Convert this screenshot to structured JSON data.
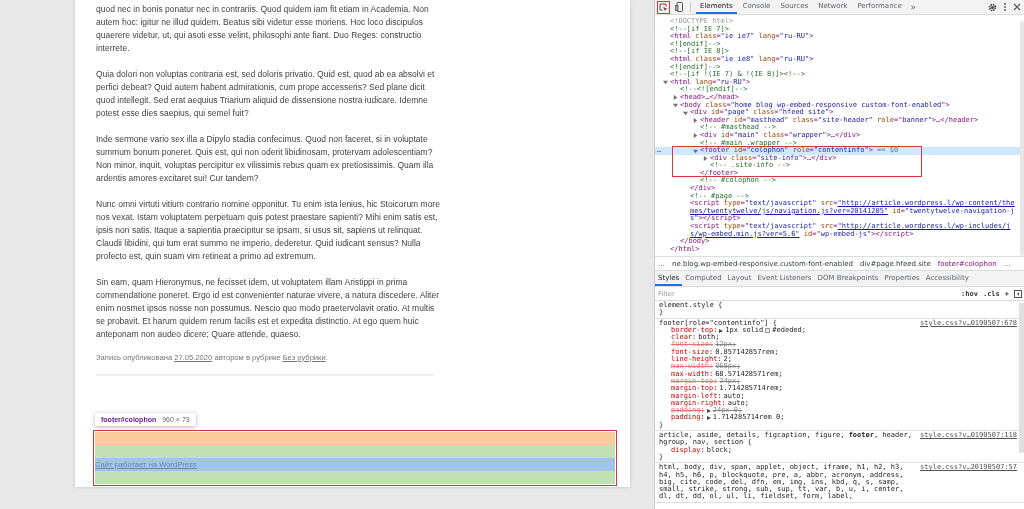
{
  "page": {
    "paragraphs": [
      "quod nec in bonis ponatur nec in contrariis. Quod quidem iam fit etiam in Academia. Non autem hoc: igitur ne illud quidem. Beatus sibi videtur esse moriens. Hoc loco discipulos quaerere videtur, ut, qui asoti esse velint, philosophi ante fiant. Duo Reges: constructio interrete.",
      "Quia dolori non voluptas contraria est, sed doloris privatio. Quid est, quod ab ea absolvi et perfici debeat? Quid autem habent admirationis, cum prope accesseris? Sed plane dicit quod intellegit. Sed erat aequius Triarium aliquid de dissensione nostra iudicare. Idemne potest esse dies saepius, qui semel fuit?",
      "Inde sermone vario sex illa a Dipylo stadia confecimus. Quod non faceret, si in voluptate summum bonum poneret. Quis est, qui non oderit libidinosam, protervam adolescentiam? Non minor, inquit, voluptas percipitur ex vilissimis rebus quam ex pretiosissimis. Quam illa ardentis amores excitaret sui! Cur tandem?",
      "Nunc omni virtuti vitium contrario nomine opponitur. Tu enim ista lenius, hic Stoicorum more nos vexat. Istam voluptatem perpetuam quis potest praestare sapienti? Mihi enim satis est, ipsis non satis. Itaque a sapientia praecipitur se ipsam, si usus sit, sapiens ut relinquat. Claudii libidini, qui tum erat summo ne imperio, dederetur. Quid iudicant sensus? Nulla profecto est, quin suam vim retineat a primo ad extremum.",
      "Sin eam, quam Hieronymus, ne fecisset idem, ut voluptatem illam Aristippi in prima commendatione poneret. Ergo id est convenienter naturae vivere, a natura discedere. Aliter enim nosmet ipsos nosse non possumus. Nescio quo modo praetervolavit oratio. At multis se probavit. Et harum quidem rerum facilis est et expedita distinctio. At ego quem huic anteponam non audeo dicere; Quare attende, quaeso."
    ],
    "post_meta": {
      "prefix": "Запись опубликована",
      "date": "27.05.2020",
      "middle": "автором в рубрике",
      "category": "Без рубрики",
      "suffix": "."
    },
    "inspect_tooltip": {
      "selector": "footer#colophon",
      "size": "960 × 73"
    },
    "footer_link": "Сайт работает на WordPress"
  },
  "devtools": {
    "tabs": [
      {
        "label": "Elements",
        "selected": true
      },
      {
        "label": "Console",
        "selected": false
      },
      {
        "label": "Sources",
        "selected": false
      },
      {
        "label": "Network",
        "selected": false
      },
      {
        "label": "Performance",
        "selected": false
      }
    ],
    "overflow": "»",
    "elements_tree": [
      {
        "kind": "doctype",
        "text": "<!DOCTYPE html>",
        "selected": false
      },
      {
        "kind": "comment",
        "text": "<!--[if IE 7]>",
        "selected": false
      },
      {
        "kind": "tag",
        "text": "<html class=\"ie ie7\" lang=\"ru-RU\">",
        "selected": false
      },
      {
        "kind": "comment",
        "text": "<![endif]-->",
        "selected": false
      },
      {
        "kind": "comment",
        "text": "<!--[if IE 8]>",
        "selected": false
      },
      {
        "kind": "tag",
        "text": "<html class=\"ie ie8\" lang=\"ru-RU\">",
        "selected": false
      },
      {
        "kind": "comment",
        "text": "<![endif]-->",
        "selected": false
      },
      {
        "kind": "comment",
        "text": "<!--[if !(IE 7) & !(IE 8)]><!-->",
        "selected": false
      },
      {
        "kind": "tag",
        "text": "<html lang=\"ru-RU\">",
        "selected": false,
        "expanded": true,
        "close": "</html>",
        "children": [
          {
            "kind": "comment",
            "text": "<!--<![endif]-->",
            "selected": false
          },
          {
            "kind": "tag",
            "text": "<head>…</head>",
            "selected": false,
            "expanded": false
          },
          {
            "kind": "tag",
            "text": "<body class=\"home blog wp-embed-responsive custom-font-enabled\">",
            "selected": false,
            "expanded": true,
            "close": "</body>",
            "children": [
              {
                "kind": "tag",
                "text": "<div id=\"page\" class=\"hfeed site\">",
                "selected": false,
                "expanded": true,
                "close": "</div>",
                "children": [
                  {
                    "kind": "tag",
                    "text": "<header id=\"masthead\" class=\"site-header\" role=\"banner\">…</header>",
                    "selected": false,
                    "expanded": false
                  },
                  {
                    "kind": "comment",
                    "text": "<!-- #masthead -->",
                    "selected": false
                  },
                  {
                    "kind": "tag",
                    "text": "<div id=\"main\" class=\"wrapper\">…</div>",
                    "selected": false,
                    "expanded": false
                  },
                  {
                    "kind": "comment",
                    "text": "<!-- #main .wrapper -->",
                    "selected": false
                  },
                  {
                    "kind": "tag",
                    "text": "<footer id=\"colophon\" role=\"contentinfo\">",
                    "selected": true,
                    "marker": "…",
                    "console_ref": "== $0",
                    "expanded": true,
                    "close": "</footer>",
                    "children": [
                      {
                        "kind": "tag",
                        "text": "<div class=\"site-info\">…</div>",
                        "selected": false,
                        "expanded": false
                      },
                      {
                        "kind": "comment",
                        "text": "<!-- .site-info -->",
                        "selected": false
                      }
                    ]
                  },
                  {
                    "kind": "comment",
                    "text": "<!-- #colophon -->",
                    "selected": false
                  }
                ]
              },
              {
                "kind": "comment",
                "text": "<!-- #page -->",
                "selected": false
              },
              {
                "kind": "tag",
                "text": "<script type=\"text/javascript\" src=\"http://article.wordpress.l/wp-content/themes/twentytwelve/js/navigation.js?ver=20141205\" id=\"twentytwelve-navigation-js\"></script>",
                "selected": false,
                "linked": true
              },
              {
                "kind": "tag",
                "text": "<script type=\"text/javascript\" src=\"http://article.wordpress.l/wp-includes/js/wp-embed.min.js?ver=5.6\" id=\"wp-embed-js\"></script>",
                "selected": false,
                "linked": true
              }
            ]
          }
        ]
      }
    ],
    "breadcrumb": {
      "lead": "…",
      "items": [
        {
          "label": "ne.blog.wp-embed-responsive.custom-font-enabled",
          "selected": false
        },
        {
          "label": "div#page.hfeed.site",
          "selected": false
        },
        {
          "label": "footer#colophon",
          "selected": true
        }
      ],
      "trail": "…"
    },
    "styles_tabs": [
      {
        "label": "Styles",
        "selected": true
      },
      {
        "label": "Computed",
        "selected": false
      },
      {
        "label": "Layout",
        "selected": false
      },
      {
        "label": "Event Listeners",
        "selected": false
      },
      {
        "label": "DOM Breakpoints",
        "selected": false
      },
      {
        "label": "Properties",
        "selected": false
      },
      {
        "label": "Accessibility",
        "selected": false
      }
    ],
    "filter": {
      "placeholder": "Filter",
      "hov": ":hov",
      "cls": ".cls",
      "add": "+"
    },
    "rules": [
      {
        "selector": "element.style {",
        "close": "}"
      },
      {
        "selector": "footer[role=\"contentinfo\"] {",
        "source": "style.css?v…0190507:678",
        "close": "}",
        "props": [
          {
            "name": "border-top:",
            "value": "1px solid",
            "color": "#ededed",
            "value_after": "#ededed;",
            "expandable": true,
            "overridden": false
          },
          {
            "name": "clear:",
            "value": "both;",
            "overridden": false
          },
          {
            "name": "font-size:",
            "value": "12px;",
            "overridden": true
          },
          {
            "name": "font-size:",
            "value": "0.857142857rem;",
            "overridden": false
          },
          {
            "name": "line-height:",
            "value": "2;",
            "overridden": false
          },
          {
            "name": "max-width:",
            "value": "960px;",
            "overridden": true
          },
          {
            "name": "max-width:",
            "value": "68.571428571rem;",
            "overridden": false
          },
          {
            "name": "margin-top:",
            "value": "24px;",
            "overridden": true
          },
          {
            "name": "margin-top:",
            "value": "1.714285714rem;",
            "overridden": false
          },
          {
            "name": "margin-left:",
            "value": "auto;",
            "overridden": false
          },
          {
            "name": "margin-right:",
            "value": "auto;",
            "overridden": false
          },
          {
            "name": "padding:",
            "value": "24px 0;",
            "expandable": true,
            "overridden": true
          },
          {
            "name": "padding:",
            "value": "1.714285714rem 0;",
            "expandable": true,
            "overridden": false
          }
        ]
      },
      {
        "selector": "article, aside, details, figcaption, figure, **footer**, header, hgroup, nav, section {",
        "source": "style.css?v…0190507:118",
        "close": "}",
        "props": [
          {
            "name": "display:",
            "value": "block;",
            "overridden": false
          }
        ]
      },
      {
        "selector": "html, body, div, span, applet, object, iframe, h1, h2, h3, h4, h5, h6, p, blockquote, pre, a, abbr, acronym, address, big, cite, code, del, dfn, em, img, ins, kbd, q, s, samp, small, strike, strong, sub, sup, tt, var, b, u, i, center, dl, dt, dd, ol, ul, li, fieldset, form, label,",
        "source": "style.css?v…20190507:57"
      }
    ]
  }
}
